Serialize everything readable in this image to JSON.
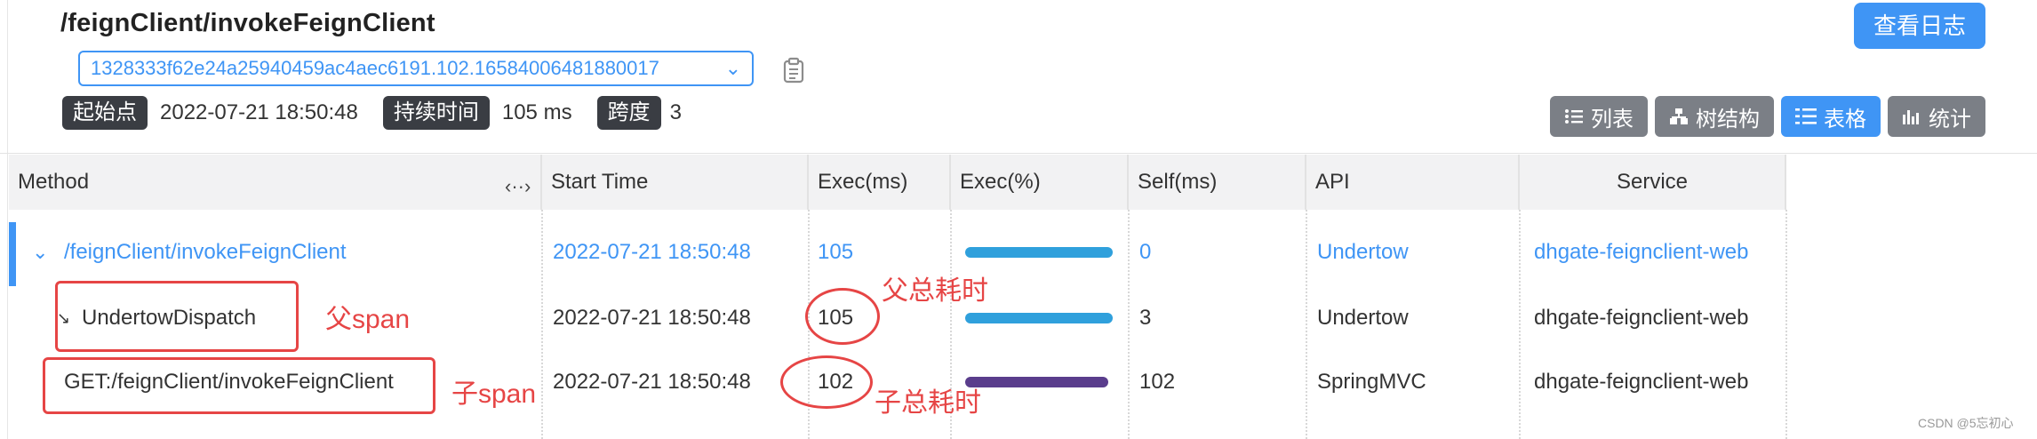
{
  "header": {
    "title": "/feignClient/invokeFeignClient",
    "trace_id": "1328333f62e24a25940459ac4aec6191.102.16584006481880017",
    "start_label": "起始点",
    "start_value": "2022-07-21 18:50:48",
    "duration_label": "持续时间",
    "duration_value": "105 ms",
    "span_label": "跨度",
    "span_value": "3",
    "log_button": "查看日志"
  },
  "view_buttons": [
    {
      "label": "列表",
      "icon": "list-icon",
      "active": false
    },
    {
      "label": "树结构",
      "icon": "tree-icon",
      "active": false
    },
    {
      "label": "表格",
      "icon": "table-icon",
      "active": true
    },
    {
      "label": "统计",
      "icon": "stats-icon",
      "active": false
    }
  ],
  "table": {
    "columns": [
      "Method",
      "Start Time",
      "Exec(ms)",
      "Exec(%)",
      "Self(ms)",
      "API",
      "Service"
    ],
    "rows": [
      {
        "method": "/feignClient/invokeFeignClient",
        "start": "2022-07-21 18:50:48",
        "exec": "105",
        "exec_pct": 1.0,
        "self": "0",
        "api": "Undertow",
        "service": "dhgate-feignclient-web",
        "selected": true
      },
      {
        "method": "UndertowDispatch",
        "start": "2022-07-21 18:50:48",
        "exec": "105",
        "exec_pct": 1.0,
        "self": "3",
        "api": "Undertow",
        "service": "dhgate-feignclient-web",
        "selected": false
      },
      {
        "method": "GET:/feignClient/invokeFeignClient",
        "start": "2022-07-21 18:50:48",
        "exec": "102",
        "exec_pct": 0.97,
        "self": "102",
        "api": "SpringMVC",
        "service": "dhgate-feignclient-web",
        "selected": false
      }
    ]
  },
  "annotations": {
    "parent_span": "父span",
    "child_span": "子span",
    "parent_total": "父总耗时",
    "child_total": "子总耗时"
  },
  "watermark": "CSDN @5忘初心",
  "colors": {
    "accent": "#3f95f5",
    "tag_bg": "#3a3d43",
    "annotation": "#e64545",
    "bar": "#2fa0dc"
  }
}
